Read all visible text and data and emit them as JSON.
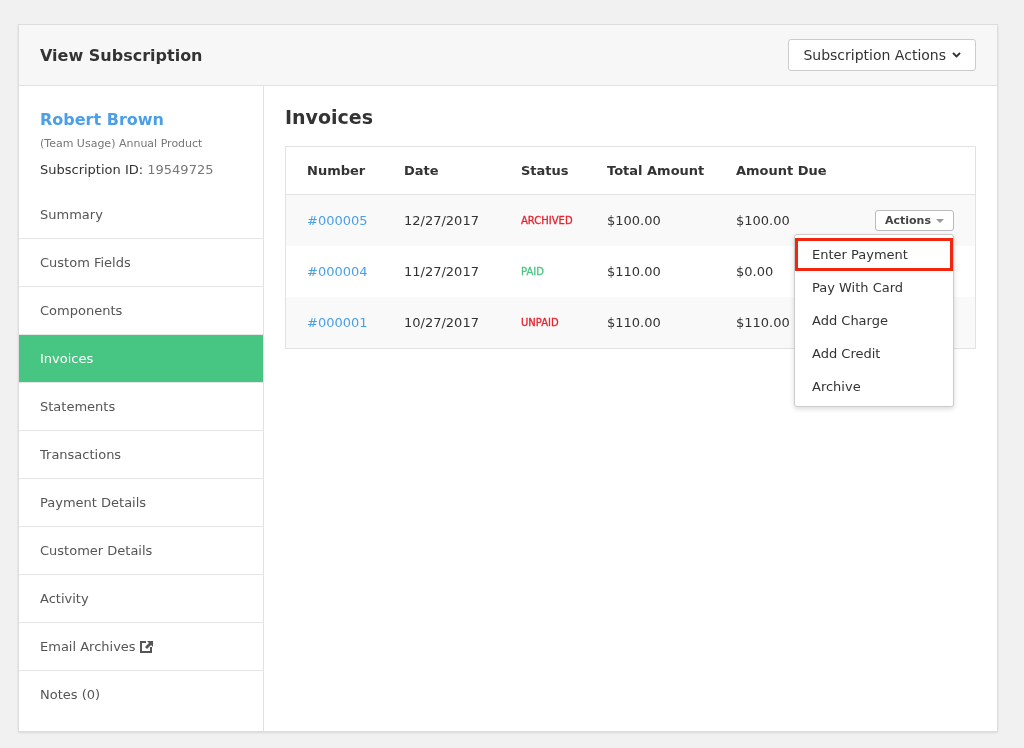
{
  "header": {
    "title": "View Subscription",
    "actions_button": "Subscription Actions"
  },
  "customer": {
    "name": "Robert Brown",
    "product": "(Team Usage) Annual Product",
    "id_label": "Subscription ID:",
    "id_value": "19549725"
  },
  "sidebar": {
    "items": [
      {
        "label": "Summary",
        "selected": false
      },
      {
        "label": "Custom Fields",
        "selected": false
      },
      {
        "label": "Components",
        "selected": false
      },
      {
        "label": "Invoices",
        "selected": true
      },
      {
        "label": "Statements",
        "selected": false
      },
      {
        "label": "Transactions",
        "selected": false
      },
      {
        "label": "Payment Details",
        "selected": false
      },
      {
        "label": "Customer Details",
        "selected": false
      },
      {
        "label": "Activity",
        "selected": false
      },
      {
        "label": "Email Archives",
        "selected": false,
        "external": true
      },
      {
        "label": "Notes (0)",
        "selected": false
      }
    ]
  },
  "invoices": {
    "title": "Invoices",
    "columns": [
      "Number",
      "Date",
      "Status",
      "Total Amount",
      "Amount Due"
    ],
    "rows": [
      {
        "number": "#000005",
        "date": "12/27/2017",
        "status": "ARCHIVED",
        "color": "#e8222f",
        "total": "$100.00",
        "due": "$100.00",
        "actions": "Actions"
      },
      {
        "number": "#000004",
        "date": "11/27/2017",
        "status": "PAID",
        "color": "#4cc485",
        "total": "$110.00",
        "due": "$0.00"
      },
      {
        "number": "#000001",
        "date": "10/27/2017",
        "status": "UNPAID",
        "color": "#e8222f",
        "total": "$110.00",
        "due": "$110.00"
      }
    ],
    "menu": [
      {
        "label": "Enter Payment",
        "highlighted": true
      },
      {
        "label": "Pay With Card",
        "highlighted": false
      },
      {
        "label": "Add Charge",
        "highlighted": false
      },
      {
        "label": "Add Credit",
        "highlighted": false
      },
      {
        "label": "Archive",
        "highlighted": false
      }
    ]
  }
}
